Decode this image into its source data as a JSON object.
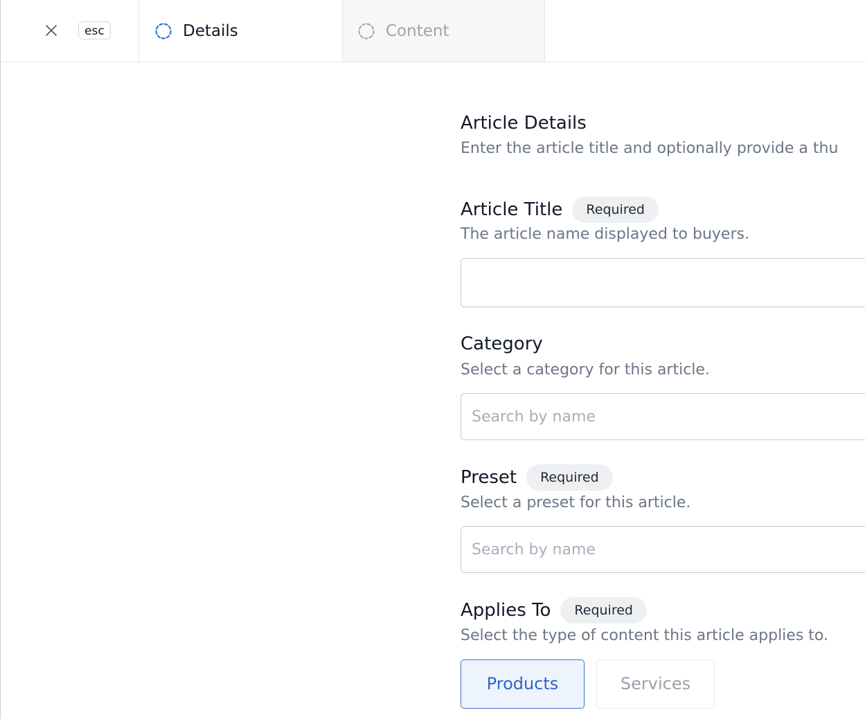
{
  "header": {
    "close_hint": "esc",
    "tabs": [
      {
        "label": "Details",
        "state": "active"
      },
      {
        "label": "Content",
        "state": "inactive"
      }
    ]
  },
  "section": {
    "title": "Article Details",
    "description": "Enter the article title and optionally provide a thu"
  },
  "fields": {
    "title": {
      "label": "Article Title",
      "badge": "Required",
      "help": "The article name displayed to buyers.",
      "value": ""
    },
    "category": {
      "label": "Category",
      "help": "Select a category for this article.",
      "placeholder": "Search by name"
    },
    "preset": {
      "label": "Preset",
      "badge": "Required",
      "help": "Select a preset for this article.",
      "placeholder": "Search by name"
    },
    "applies_to": {
      "label": "Applies To",
      "badge": "Required",
      "help": "Select the type of content this article applies to.",
      "options": [
        {
          "label": "Products",
          "selected": true
        },
        {
          "label": "Services",
          "selected": false
        }
      ]
    }
  },
  "colors": {
    "accent": "#2d64c8",
    "active_tab_icon": "#3b6fd0",
    "inactive_tab_icon": "#9ca3af",
    "muted_text": "#6b7686",
    "pill_bg": "#eeeff1"
  },
  "icons": {
    "close": "close-icon",
    "tab_details": "dashed-circle-icon",
    "tab_content": "dashed-circle-icon"
  }
}
